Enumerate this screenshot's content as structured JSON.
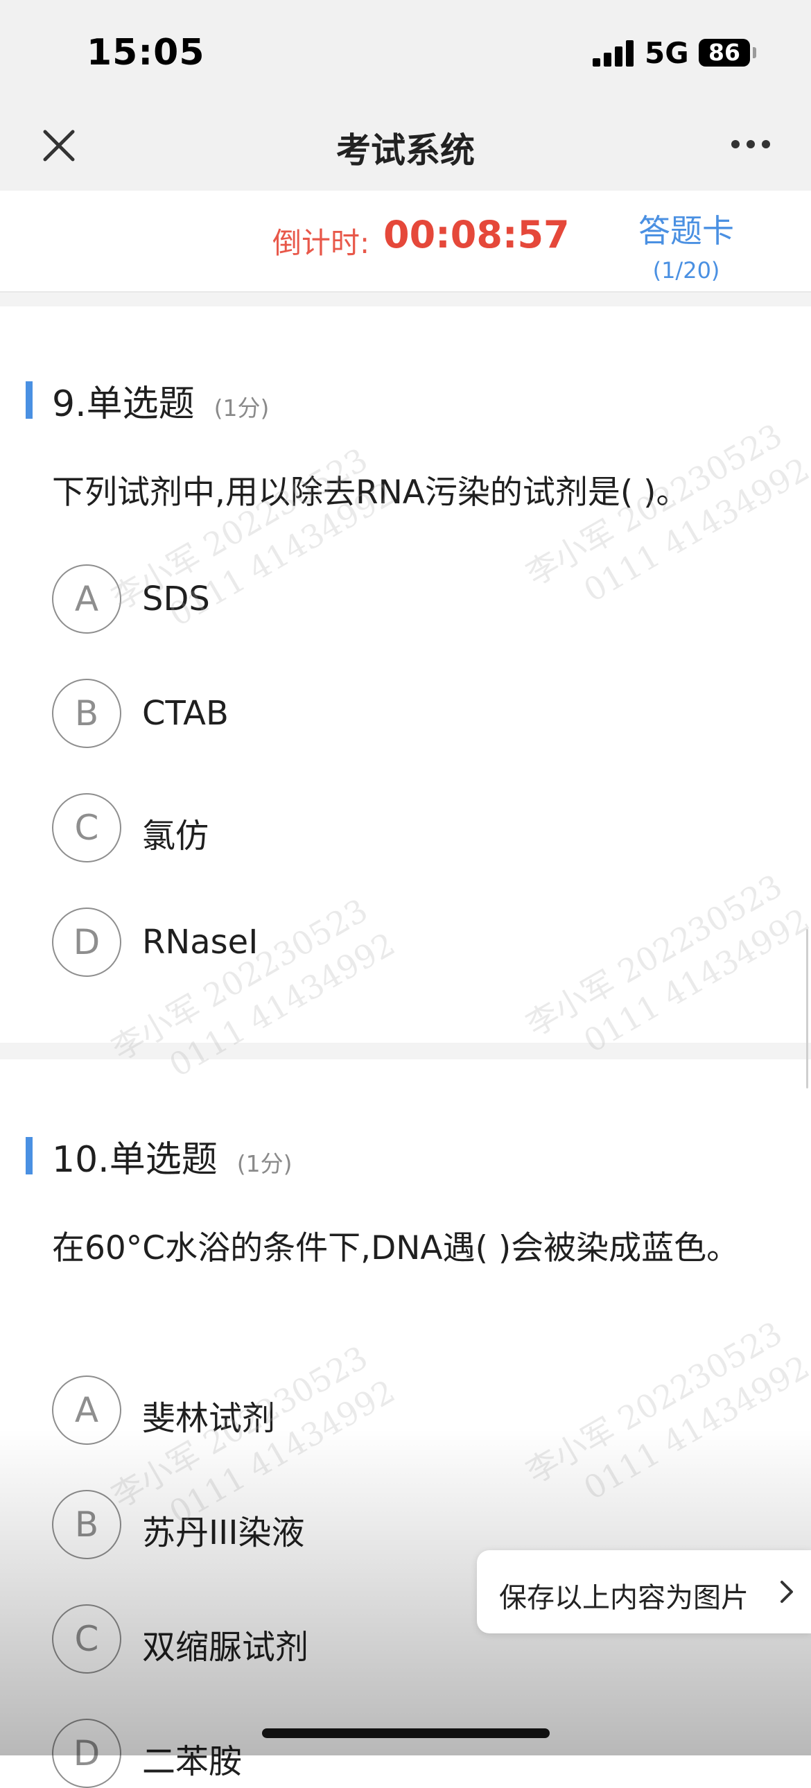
{
  "status_bar": {
    "time": "15:05",
    "network": "5G",
    "battery": "86"
  },
  "nav": {
    "title": "考试系统",
    "close_icon": "close-icon",
    "more_icon": "more-icon"
  },
  "timer": {
    "label": "倒计时:",
    "value": "00:08:57"
  },
  "answer_card": {
    "label": "答题卡",
    "progress": "(1/20)"
  },
  "questions": [
    {
      "title": "9.单选题",
      "score": "(1分)",
      "stem": "下列试剂中,用以除去RNA污染的试剂是(    )。",
      "options": [
        {
          "letter": "A",
          "text": "SDS"
        },
        {
          "letter": "B",
          "text": "CTAB"
        },
        {
          "letter": "C",
          "text": "氯仿"
        },
        {
          "letter": "D",
          "text": "RNaseI"
        }
      ]
    },
    {
      "title": "10.单选题",
      "score": "(1分)",
      "stem": "在60°C水浴的条件下,DNA遇(        )会被染成蓝色。",
      "options": [
        {
          "letter": "A",
          "text": "斐林试剂"
        },
        {
          "letter": "B",
          "text": "苏丹III染液"
        },
        {
          "letter": "C",
          "text": "双缩脲试剂"
        },
        {
          "letter": "D",
          "text": "二苯胺"
        }
      ]
    }
  ],
  "watermark": {
    "line1": "李小军 202230523",
    "line2": "0111 41434992"
  },
  "save_toast": {
    "label": "保存以上内容为图片"
  }
}
